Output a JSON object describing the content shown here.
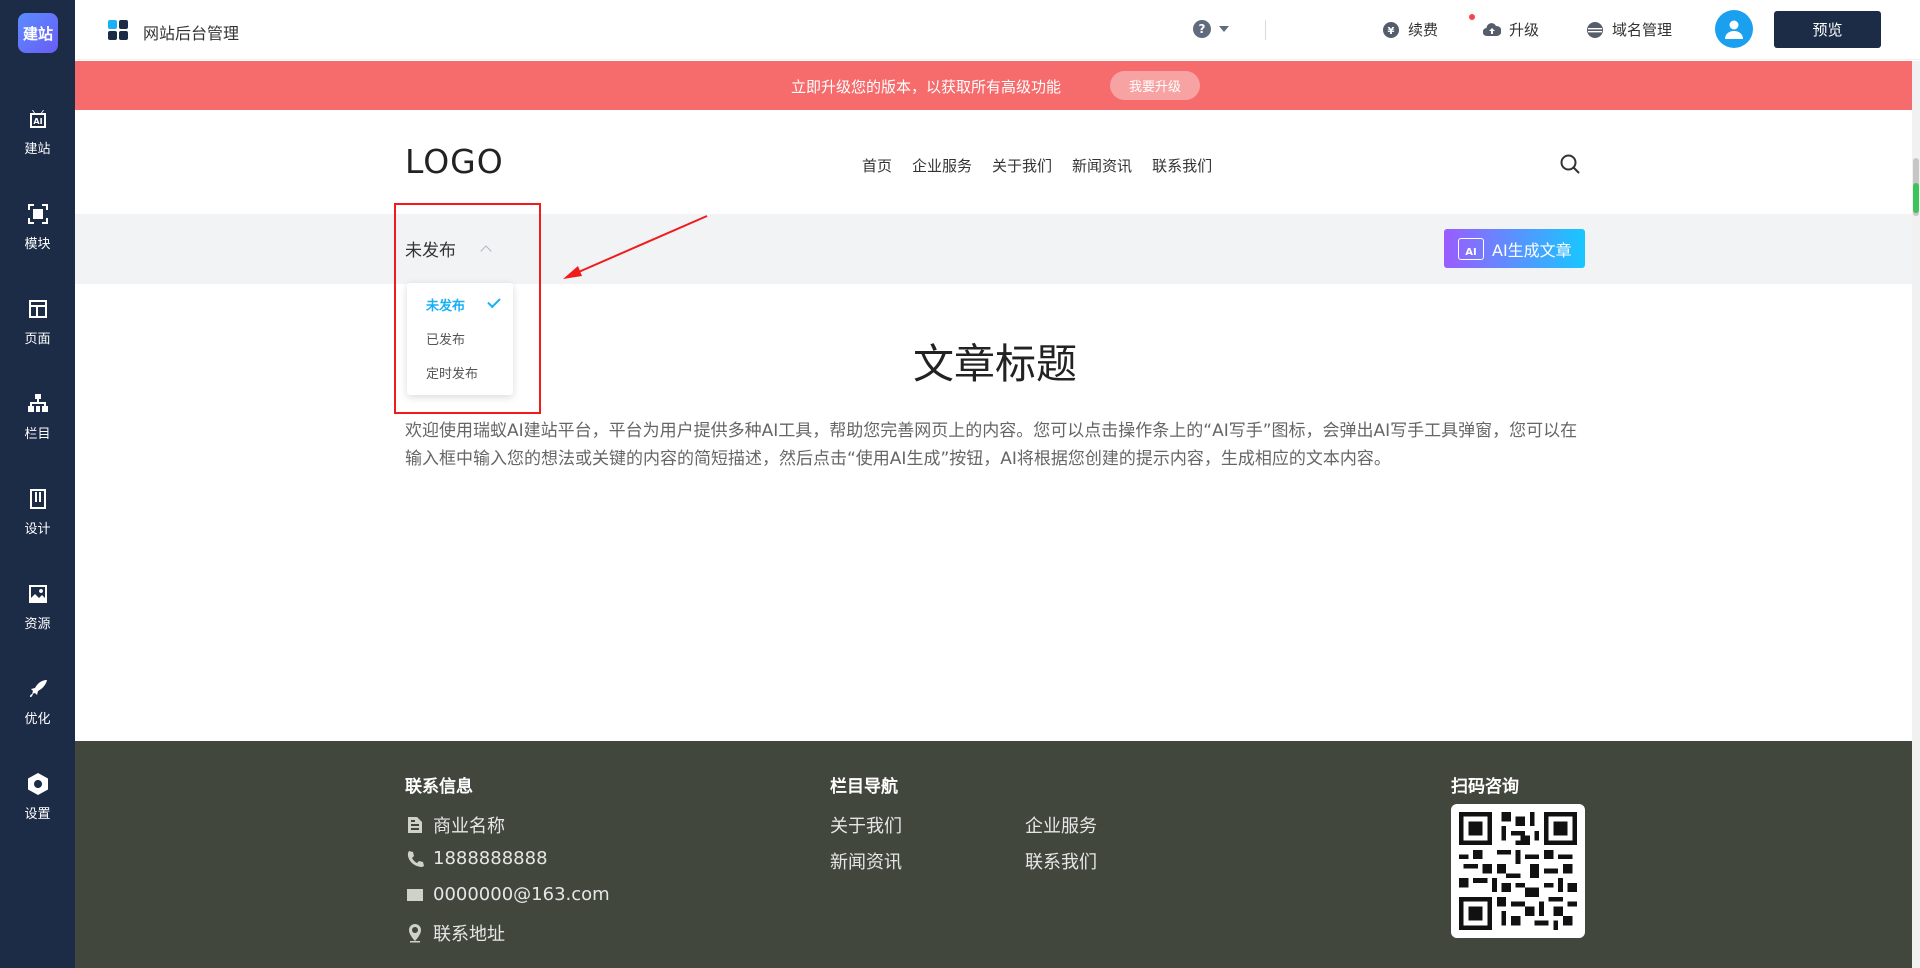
{
  "sidebar": {
    "brand": "建站",
    "items": [
      {
        "label": "建站",
        "icon": "ai-robot-icon"
      },
      {
        "label": "模块",
        "icon": "module-icon"
      },
      {
        "label": "页面",
        "icon": "page-icon"
      },
      {
        "label": "栏目",
        "icon": "sitemap-icon"
      },
      {
        "label": "设计",
        "icon": "design-icon"
      },
      {
        "label": "资源",
        "icon": "image-icon"
      },
      {
        "label": "优化",
        "icon": "rocket-icon"
      },
      {
        "label": "设置",
        "icon": "settings-icon"
      }
    ]
  },
  "topbar": {
    "title": "网站后台管理",
    "help": "?",
    "renew": "续费",
    "upgrade": "升级",
    "domain": "域名管理",
    "preview": "预览"
  },
  "banner": {
    "text": "立即升级您的版本，以获取所有高级功能",
    "button": "我要升级"
  },
  "site": {
    "logo": "LOGO",
    "nav": [
      "首页",
      "企业服务",
      "关于我们",
      "新闻资讯",
      "联系我们"
    ]
  },
  "status": {
    "selected": "未发布",
    "options": [
      "未发布",
      "已发布",
      "定时发布"
    ],
    "ai_button": "AI生成文章",
    "ai_badge": "AI"
  },
  "article": {
    "title": "文章标题",
    "body": "欢迎使用瑞蚁AI建站平台，平台为用户提供多种AI工具，帮助您完善网页上的内容。您可以点击操作条上的“AI写手”图标，会弹出AI写手工具弹窗，您可以在输入框中输入您的想法或关键的内容的简短描述，然后点击“使用AI生成”按钮，AI将根据您创建的提示内容，生成相应的文本内容。"
  },
  "footer": {
    "contact_title": "联系信息",
    "company": "商业名称",
    "phone": "1888888888",
    "email": "0000000@163.com",
    "address": "联系地址",
    "nav_title": "栏目导航",
    "nav": [
      "关于我们",
      "企业服务",
      "新闻资讯",
      "联系我们"
    ],
    "qr_title": "扫码咨询"
  },
  "colors": {
    "sidebar": "#1c2b46",
    "banner": "#f66b6b",
    "footer": "#41473d",
    "accent": "#1ab0f5",
    "highlight": "#f01c1c"
  }
}
